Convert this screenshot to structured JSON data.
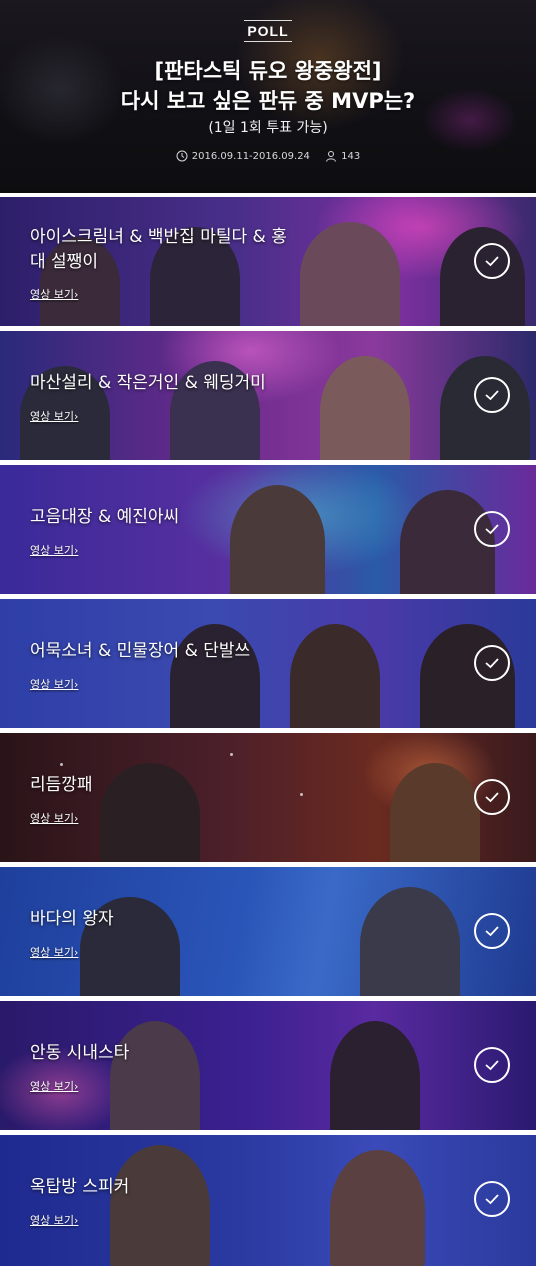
{
  "header": {
    "badge": "POLL",
    "title_line1": "[판타스틱 듀오 왕중왕전]",
    "title_line2": "다시 보고 싶은 판듀 중 MVP는?",
    "subtitle": "(1일 1회 투표 가능)",
    "period": "2016.09.11-2016.09.24",
    "participants": "143"
  },
  "candidates": [
    {
      "name": "아이스크림녀 & 백반집 마틸다 & 홍대 설쨍이",
      "link": "영상 보기"
    },
    {
      "name": "마산설리 & 작은거인 & 웨딩거미",
      "link": "영상 보기"
    },
    {
      "name": "고음대장 & 예진아씨",
      "link": "영상 보기"
    },
    {
      "name": "어묵소녀 & 민물장어 & 단발쓰",
      "link": "영상 보기"
    },
    {
      "name": "리듬깡패",
      "link": "영상 보기"
    },
    {
      "name": "바다의 왕자",
      "link": "영상 보기"
    },
    {
      "name": "안동 시내스타",
      "link": "영상 보기"
    },
    {
      "name": "옥탑방 스피커",
      "link": "영상 보기"
    }
  ],
  "icons": {
    "clock": "clock-icon",
    "person": "person-icon",
    "check": "check-icon",
    "chevron": "chevron-right-icon"
  },
  "colors": {
    "card_backgrounds": [
      "#4a2f8a",
      "#6b2a8c",
      "#3a2a9a",
      "#2f3fa8",
      "#4a1f2a",
      "#1f3f9c",
      "#3a2090",
      "#2a3aa0"
    ]
  }
}
